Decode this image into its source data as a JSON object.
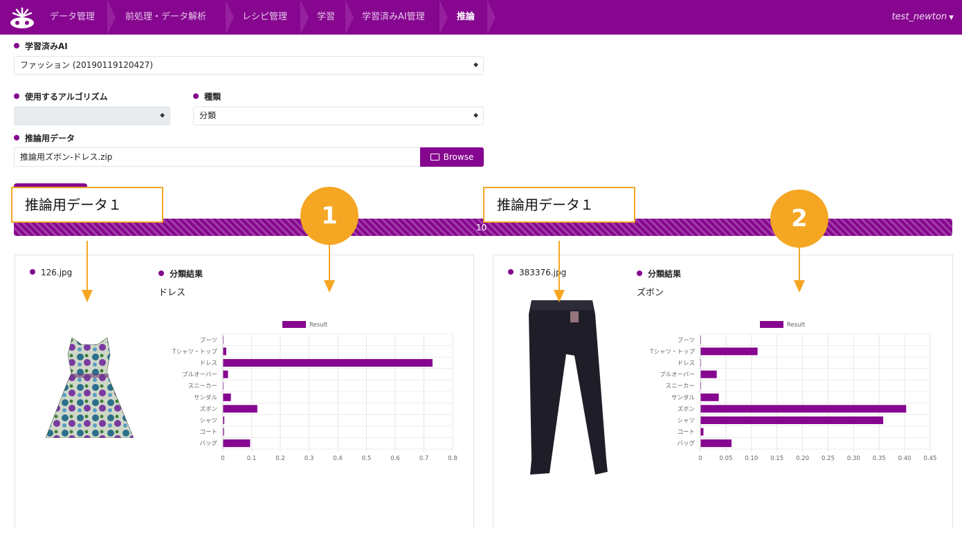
{
  "nav": {
    "crumbs": [
      "データ管理",
      "前処理・データ解析",
      "レシピ管理",
      "学習",
      "学習済みAI管理",
      "推論"
    ],
    "active_index": 5,
    "user": "test_newton"
  },
  "form": {
    "trained_ai_label": "学習済みAI",
    "trained_ai_value": "ファッション (20190119120427)",
    "algorithm_label": "使用するアルゴリズム",
    "algorithm_value": "",
    "kind_label": "種類",
    "kind_value": "分類",
    "data_label": "推論用データ",
    "data_file": "推論用ズボン-ドレス.zip",
    "browse_label": "Browse"
  },
  "progress": {
    "percent": 100,
    "text": "10"
  },
  "callouts": [
    {
      "text": "推論用データ１",
      "badge": "1"
    },
    {
      "text": "推論用データ１",
      "badge": "2"
    }
  ],
  "results": [
    {
      "file": "126.jpg",
      "result_label": "分類結果",
      "result": "ドレス",
      "image": "dress-photo"
    },
    {
      "file": "383376.jpg",
      "result_label": "分類結果",
      "result": "ズボン",
      "image": "pants-photo"
    }
  ],
  "chart_data": [
    {
      "type": "bar",
      "orientation": "horizontal",
      "legend": "Result",
      "categories": [
        "ブーツ",
        "Tシャツ・トップ",
        "ドレス",
        "プルオーバー",
        "スニーカー",
        "サンダル",
        "ズボン",
        "シャツ",
        "コート",
        "バッグ"
      ],
      "values": [
        0.001,
        0.012,
        0.73,
        0.018,
        0.001,
        0.028,
        0.12,
        0.005,
        0.004,
        0.095
      ],
      "xlim": [
        0,
        0.8
      ],
      "xticks": [
        "0",
        "0.1",
        "0.2",
        "0.3",
        "0.4",
        "0.5",
        "0.6",
        "0.7",
        "0.8"
      ],
      "color": "#86068f",
      "grid": true
    },
    {
      "type": "bar",
      "orientation": "horizontal",
      "legend": "Result",
      "categories": [
        "ブーツ",
        "Tシャツ・トップ",
        "ドレス",
        "プルオーバー",
        "スニーカー",
        "サンダル",
        "ズボン",
        "シャツ",
        "コート",
        "バッグ"
      ],
      "values": [
        0.001,
        0.112,
        0.001,
        0.032,
        0.001,
        0.036,
        0.403,
        0.358,
        0.006,
        0.061
      ],
      "xlim": [
        0,
        0.45
      ],
      "xticks": [
        "0",
        "0.05",
        "0.10",
        "0.15",
        "0.20",
        "0.25",
        "0.30",
        "0.35",
        "0.40",
        "0.45"
      ],
      "color": "#86068f",
      "grid": true
    }
  ],
  "colors": {
    "brand": "#86068f",
    "callout": "#f5a623"
  }
}
